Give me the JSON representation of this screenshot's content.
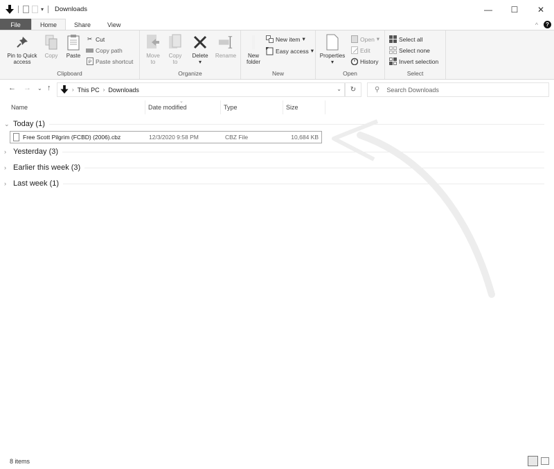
{
  "window": {
    "title": "Downloads",
    "controls": {
      "minimize": "—",
      "maximize": "☐",
      "close": "✕"
    }
  },
  "ribbon_tabs": [
    {
      "label": "File"
    },
    {
      "label": "Home"
    },
    {
      "label": "Share"
    },
    {
      "label": "View"
    }
  ],
  "ribbon": {
    "help": "?",
    "collapse": "^",
    "clipboard": {
      "label": "Clipboard",
      "pin": "Pin to Quick access",
      "copy": "Copy",
      "paste": "Paste",
      "cut": "Cut",
      "copy_path": "Copy path",
      "paste_shortcut": "Paste shortcut"
    },
    "organize": {
      "label": "Organize",
      "move_to": "Move to",
      "copy_to": "Copy to",
      "delete": "Delete",
      "rename": "Rename"
    },
    "new": {
      "label": "New",
      "new_folder": "New folder",
      "new_item": "New item",
      "easy_access": "Easy access"
    },
    "open": {
      "label": "Open",
      "properties": "Properties",
      "open": "Open",
      "edit": "Edit",
      "history": "History"
    },
    "select": {
      "label": "Select",
      "select_all": "Select all",
      "select_none": "Select none",
      "invert_selection": "Invert selection"
    }
  },
  "address": {
    "breadcrumb": [
      "This PC",
      "Downloads"
    ],
    "search_placeholder": "Search Downloads"
  },
  "columns": [
    "Name",
    "Date modified",
    "Type",
    "Size"
  ],
  "groups": [
    {
      "title": "Today (1)",
      "expanded": true,
      "files": [
        {
          "name": "Free Scott Pilgrim (FCBD) (2006).cbz",
          "date": "12/3/2020 9:58 PM",
          "type": "CBZ File",
          "size": "10,684 KB"
        }
      ]
    },
    {
      "title": "Yesterday (3)",
      "expanded": false
    },
    {
      "title": "Earlier this week (3)",
      "expanded": false
    },
    {
      "title": "Last week (1)",
      "expanded": false
    }
  ],
  "status": {
    "item_count": "8 items"
  }
}
